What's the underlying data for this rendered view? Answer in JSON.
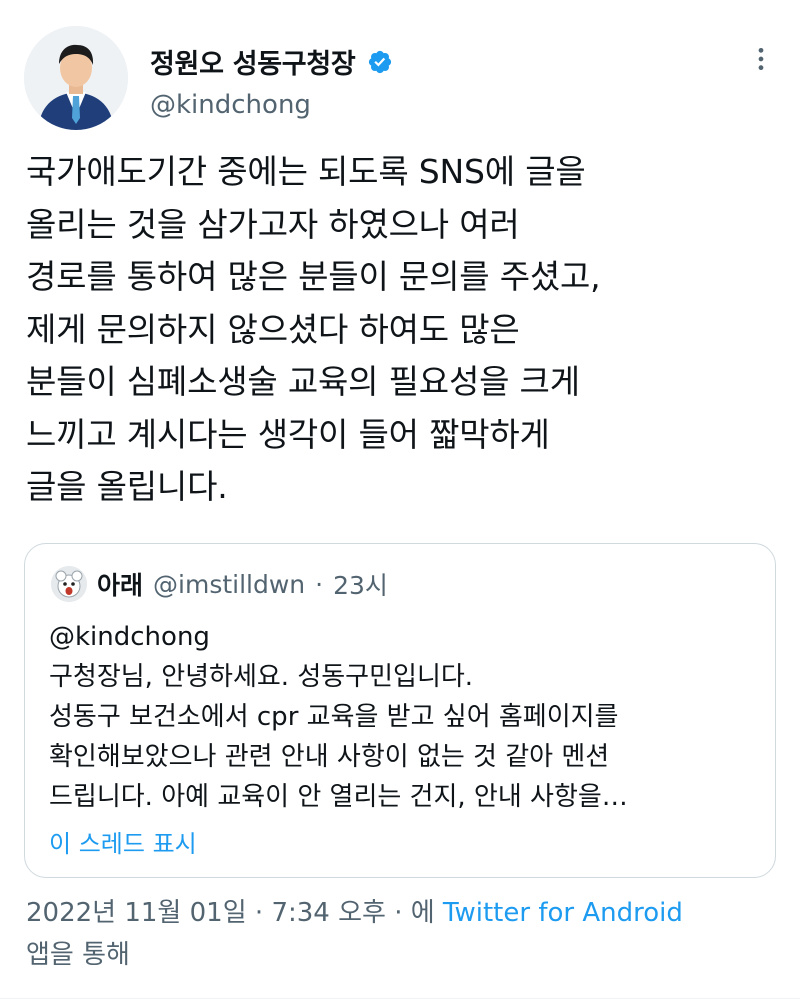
{
  "author": {
    "display_name": "정원오 성동구청장",
    "handle": "@kindchong",
    "verified": true
  },
  "tweet": {
    "text": "국가애도기간 중에는 되도록 SNS에 글을\n올리는 것을 삼가고자 하였으나 여러\n경로를 통하여 많은 분들이 문의를 주셨고,\n제게 문의하지 않으셨다 하여도 많은\n분들이 심폐소생술 교육의 필요성을 크게\n느끼고 계시다는 생각이 들어 짧막하게\n글을 올립니다.",
    "date": "2022년 11월 01일",
    "separator": "·",
    "time": "7:34 오후",
    "via_prefix": "· 에",
    "source": "Twitter for Android",
    "via_suffix": "앱을 통해"
  },
  "quoted_tweet": {
    "display_name": "아래",
    "handle": "@imstilldwn",
    "separator": "·",
    "time": "23시",
    "text": "@kindchong\n구청장님, 안녕하세요. 성동구민입니다.\n성동구 보건소에서 cpr 교육을 받고 싶어 홈페이지를\n확인해보았으나 관련 안내 사항이 없는 것 같아 멘션\n드립니다. 아예 교육이 안 열리는 건지, 안내 사항을…",
    "show_thread": "이 스레드 표시"
  },
  "colors": {
    "text": "#0f1419",
    "secondary": "#536471",
    "accent": "#1d9bf0",
    "border": "#cfd9de"
  }
}
